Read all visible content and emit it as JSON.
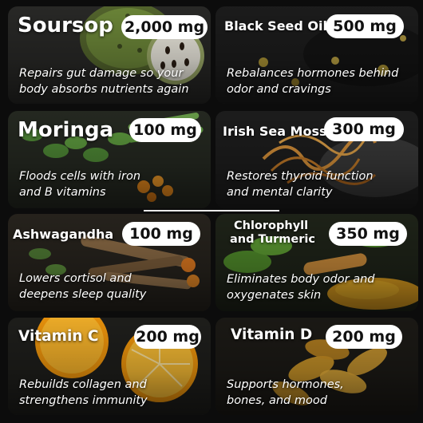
{
  "cards": [
    {
      "name": "Soursop",
      "dose": "2,000 mg",
      "desc1": "Repairs gut damage so your",
      "desc2": "body absorbs nutrients again"
    },
    {
      "name": "Black Seed Oil",
      "dose": "500 mg",
      "desc1": "Rebalances hormones behind",
      "desc2": "odor and cravings"
    },
    {
      "name": "Moringa",
      "dose": "100 mg",
      "desc1": "Floods cells with iron",
      "desc2": "and B vitamins"
    },
    {
      "name": "Irish Sea Moss",
      "dose": "300 mg",
      "desc1": "Restores thyroid function",
      "desc2": "and mental clarity"
    },
    {
      "name": "Ashwagandha",
      "dose": "100 mg",
      "desc1": "Lowers cortisol and",
      "desc2": "deepens sleep quality"
    },
    {
      "name_line1": "Chlorophyll",
      "name_line2": "and Turmeric",
      "dose": "350 mg",
      "desc1": "Eliminates body odor and",
      "desc2": "oxygenates skin"
    },
    {
      "name": "Vitamin C",
      "dose": "200 mg",
      "desc1": "Rebuilds collagen and",
      "desc2": "strengthens immunity"
    },
    {
      "name": "Vitamin D",
      "dose": "200 mg",
      "desc1": "Supports hormones,",
      "desc2": "bones, and mood"
    }
  ]
}
